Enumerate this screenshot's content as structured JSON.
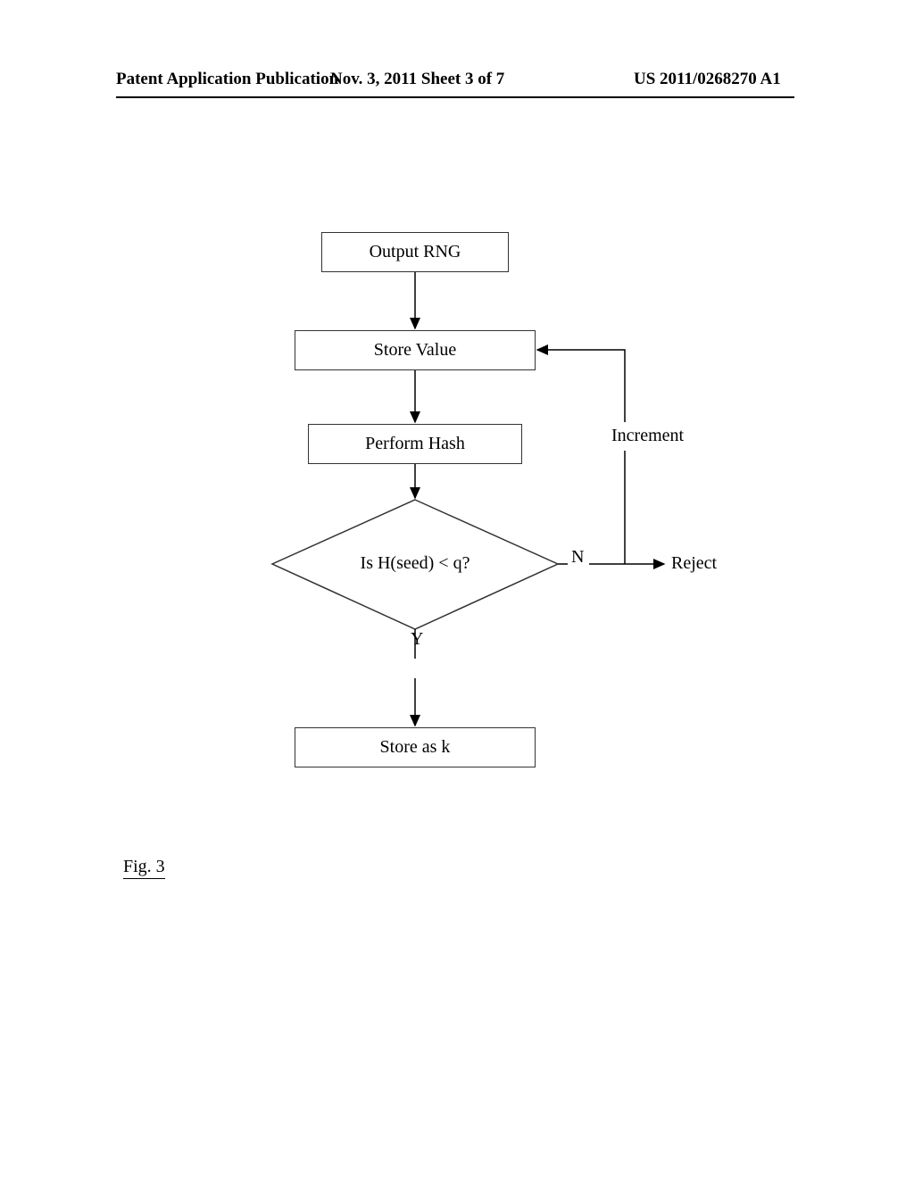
{
  "header": {
    "left": "Patent Application Publication",
    "center": "Nov. 3, 2011  Sheet 3 of 7",
    "right": "US 2011/0268270 A1"
  },
  "flowchart": {
    "b1": "Output RNG",
    "b2": "Store Value",
    "b3": "Perform Hash",
    "decision": "Is H(seed) < q?",
    "yes": "Y",
    "no": "N",
    "increment": "Increment",
    "reject": "Reject",
    "b5": "Store as k"
  },
  "figure_label": "Fig. 3"
}
